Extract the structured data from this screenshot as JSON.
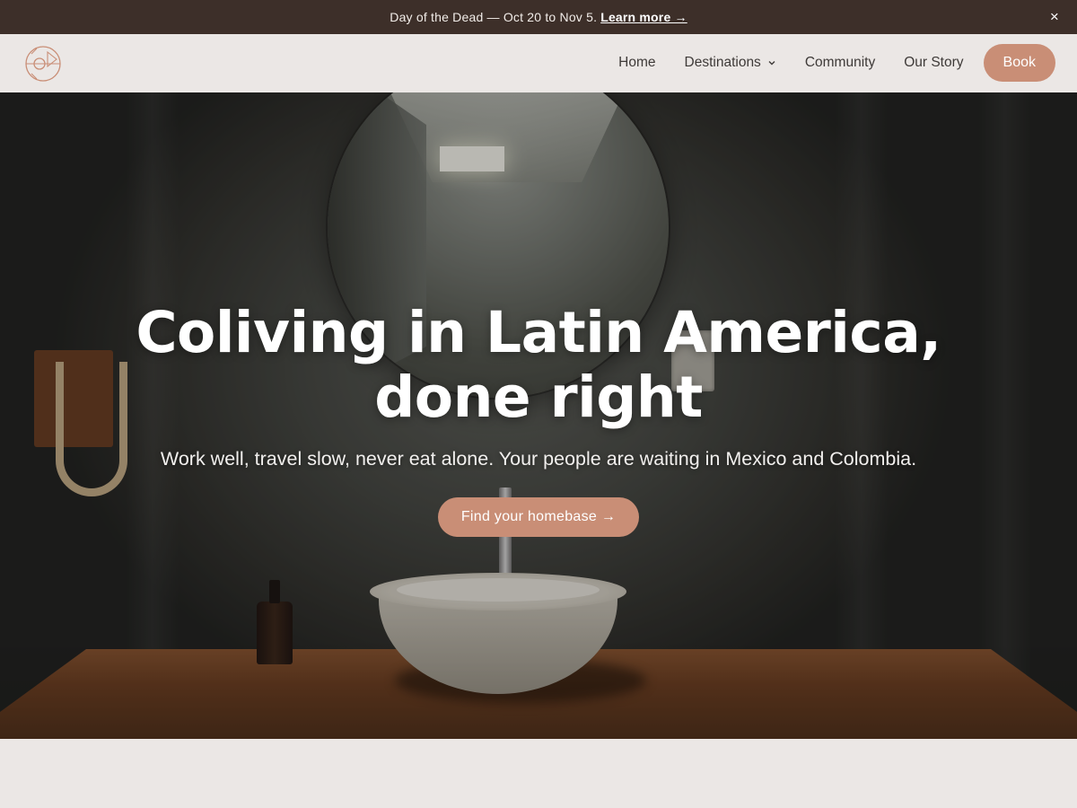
{
  "announcement": {
    "text": "Day of the Dead — Oct 20 to Nov 5.",
    "link_label": "Learn more →",
    "close_label": "×"
  },
  "nav": {
    "items": [
      {
        "label": "Home"
      },
      {
        "label": "Destinations",
        "has_dropdown": true
      },
      {
        "label": "Community"
      },
      {
        "label": "Our Story"
      }
    ],
    "book_label": "Book"
  },
  "hero": {
    "title_line1": "Coliving in Latin America,",
    "title_line2": "done right",
    "subtitle": "Work well, travel slow, never eat alone. Your people are waiting in Mexico and Colombia.",
    "cta_label": "Find your homebase →"
  },
  "colors": {
    "accent": "#c98e76",
    "announcement_bg": "#3d2f29",
    "page_bg": "#ebe7e5"
  },
  "icons": {
    "logo": "circular-line-logo-icon",
    "dropdown": "chevron-down-icon",
    "close": "close-icon"
  }
}
